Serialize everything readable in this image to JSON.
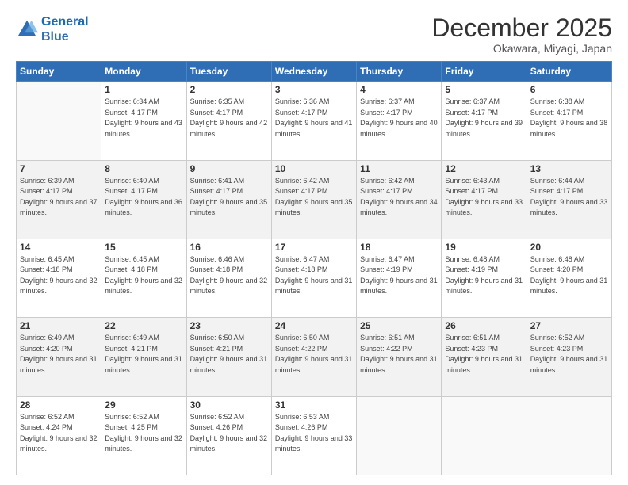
{
  "header": {
    "logo_general": "General",
    "logo_blue": "Blue",
    "month_title": "December 2025",
    "location": "Okawara, Miyagi, Japan"
  },
  "days_of_week": [
    "Sunday",
    "Monday",
    "Tuesday",
    "Wednesday",
    "Thursday",
    "Friday",
    "Saturday"
  ],
  "weeks": [
    [
      {
        "day": "",
        "sunrise": "",
        "sunset": "",
        "daylight": ""
      },
      {
        "day": "1",
        "sunrise": "Sunrise: 6:34 AM",
        "sunset": "Sunset: 4:17 PM",
        "daylight": "Daylight: 9 hours and 43 minutes."
      },
      {
        "day": "2",
        "sunrise": "Sunrise: 6:35 AM",
        "sunset": "Sunset: 4:17 PM",
        "daylight": "Daylight: 9 hours and 42 minutes."
      },
      {
        "day": "3",
        "sunrise": "Sunrise: 6:36 AM",
        "sunset": "Sunset: 4:17 PM",
        "daylight": "Daylight: 9 hours and 41 minutes."
      },
      {
        "day": "4",
        "sunrise": "Sunrise: 6:37 AM",
        "sunset": "Sunset: 4:17 PM",
        "daylight": "Daylight: 9 hours and 40 minutes."
      },
      {
        "day": "5",
        "sunrise": "Sunrise: 6:37 AM",
        "sunset": "Sunset: 4:17 PM",
        "daylight": "Daylight: 9 hours and 39 minutes."
      },
      {
        "day": "6",
        "sunrise": "Sunrise: 6:38 AM",
        "sunset": "Sunset: 4:17 PM",
        "daylight": "Daylight: 9 hours and 38 minutes."
      }
    ],
    [
      {
        "day": "7",
        "sunrise": "Sunrise: 6:39 AM",
        "sunset": "Sunset: 4:17 PM",
        "daylight": "Daylight: 9 hours and 37 minutes."
      },
      {
        "day": "8",
        "sunrise": "Sunrise: 6:40 AM",
        "sunset": "Sunset: 4:17 PM",
        "daylight": "Daylight: 9 hours and 36 minutes."
      },
      {
        "day": "9",
        "sunrise": "Sunrise: 6:41 AM",
        "sunset": "Sunset: 4:17 PM",
        "daylight": "Daylight: 9 hours and 35 minutes."
      },
      {
        "day": "10",
        "sunrise": "Sunrise: 6:42 AM",
        "sunset": "Sunset: 4:17 PM",
        "daylight": "Daylight: 9 hours and 35 minutes."
      },
      {
        "day": "11",
        "sunrise": "Sunrise: 6:42 AM",
        "sunset": "Sunset: 4:17 PM",
        "daylight": "Daylight: 9 hours and 34 minutes."
      },
      {
        "day": "12",
        "sunrise": "Sunrise: 6:43 AM",
        "sunset": "Sunset: 4:17 PM",
        "daylight": "Daylight: 9 hours and 33 minutes."
      },
      {
        "day": "13",
        "sunrise": "Sunrise: 6:44 AM",
        "sunset": "Sunset: 4:17 PM",
        "daylight": "Daylight: 9 hours and 33 minutes."
      }
    ],
    [
      {
        "day": "14",
        "sunrise": "Sunrise: 6:45 AM",
        "sunset": "Sunset: 4:18 PM",
        "daylight": "Daylight: 9 hours and 32 minutes."
      },
      {
        "day": "15",
        "sunrise": "Sunrise: 6:45 AM",
        "sunset": "Sunset: 4:18 PM",
        "daylight": "Daylight: 9 hours and 32 minutes."
      },
      {
        "day": "16",
        "sunrise": "Sunrise: 6:46 AM",
        "sunset": "Sunset: 4:18 PM",
        "daylight": "Daylight: 9 hours and 32 minutes."
      },
      {
        "day": "17",
        "sunrise": "Sunrise: 6:47 AM",
        "sunset": "Sunset: 4:18 PM",
        "daylight": "Daylight: 9 hours and 31 minutes."
      },
      {
        "day": "18",
        "sunrise": "Sunrise: 6:47 AM",
        "sunset": "Sunset: 4:19 PM",
        "daylight": "Daylight: 9 hours and 31 minutes."
      },
      {
        "day": "19",
        "sunrise": "Sunrise: 6:48 AM",
        "sunset": "Sunset: 4:19 PM",
        "daylight": "Daylight: 9 hours and 31 minutes."
      },
      {
        "day": "20",
        "sunrise": "Sunrise: 6:48 AM",
        "sunset": "Sunset: 4:20 PM",
        "daylight": "Daylight: 9 hours and 31 minutes."
      }
    ],
    [
      {
        "day": "21",
        "sunrise": "Sunrise: 6:49 AM",
        "sunset": "Sunset: 4:20 PM",
        "daylight": "Daylight: 9 hours and 31 minutes."
      },
      {
        "day": "22",
        "sunrise": "Sunrise: 6:49 AM",
        "sunset": "Sunset: 4:21 PM",
        "daylight": "Daylight: 9 hours and 31 minutes."
      },
      {
        "day": "23",
        "sunrise": "Sunrise: 6:50 AM",
        "sunset": "Sunset: 4:21 PM",
        "daylight": "Daylight: 9 hours and 31 minutes."
      },
      {
        "day": "24",
        "sunrise": "Sunrise: 6:50 AM",
        "sunset": "Sunset: 4:22 PM",
        "daylight": "Daylight: 9 hours and 31 minutes."
      },
      {
        "day": "25",
        "sunrise": "Sunrise: 6:51 AM",
        "sunset": "Sunset: 4:22 PM",
        "daylight": "Daylight: 9 hours and 31 minutes."
      },
      {
        "day": "26",
        "sunrise": "Sunrise: 6:51 AM",
        "sunset": "Sunset: 4:23 PM",
        "daylight": "Daylight: 9 hours and 31 minutes."
      },
      {
        "day": "27",
        "sunrise": "Sunrise: 6:52 AM",
        "sunset": "Sunset: 4:23 PM",
        "daylight": "Daylight: 9 hours and 31 minutes."
      }
    ],
    [
      {
        "day": "28",
        "sunrise": "Sunrise: 6:52 AM",
        "sunset": "Sunset: 4:24 PM",
        "daylight": "Daylight: 9 hours and 32 minutes."
      },
      {
        "day": "29",
        "sunrise": "Sunrise: 6:52 AM",
        "sunset": "Sunset: 4:25 PM",
        "daylight": "Daylight: 9 hours and 32 minutes."
      },
      {
        "day": "30",
        "sunrise": "Sunrise: 6:52 AM",
        "sunset": "Sunset: 4:26 PM",
        "daylight": "Daylight: 9 hours and 32 minutes."
      },
      {
        "day": "31",
        "sunrise": "Sunrise: 6:53 AM",
        "sunset": "Sunset: 4:26 PM",
        "daylight": "Daylight: 9 hours and 33 minutes."
      },
      {
        "day": "",
        "sunrise": "",
        "sunset": "",
        "daylight": ""
      },
      {
        "day": "",
        "sunrise": "",
        "sunset": "",
        "daylight": ""
      },
      {
        "day": "",
        "sunrise": "",
        "sunset": "",
        "daylight": ""
      }
    ]
  ]
}
